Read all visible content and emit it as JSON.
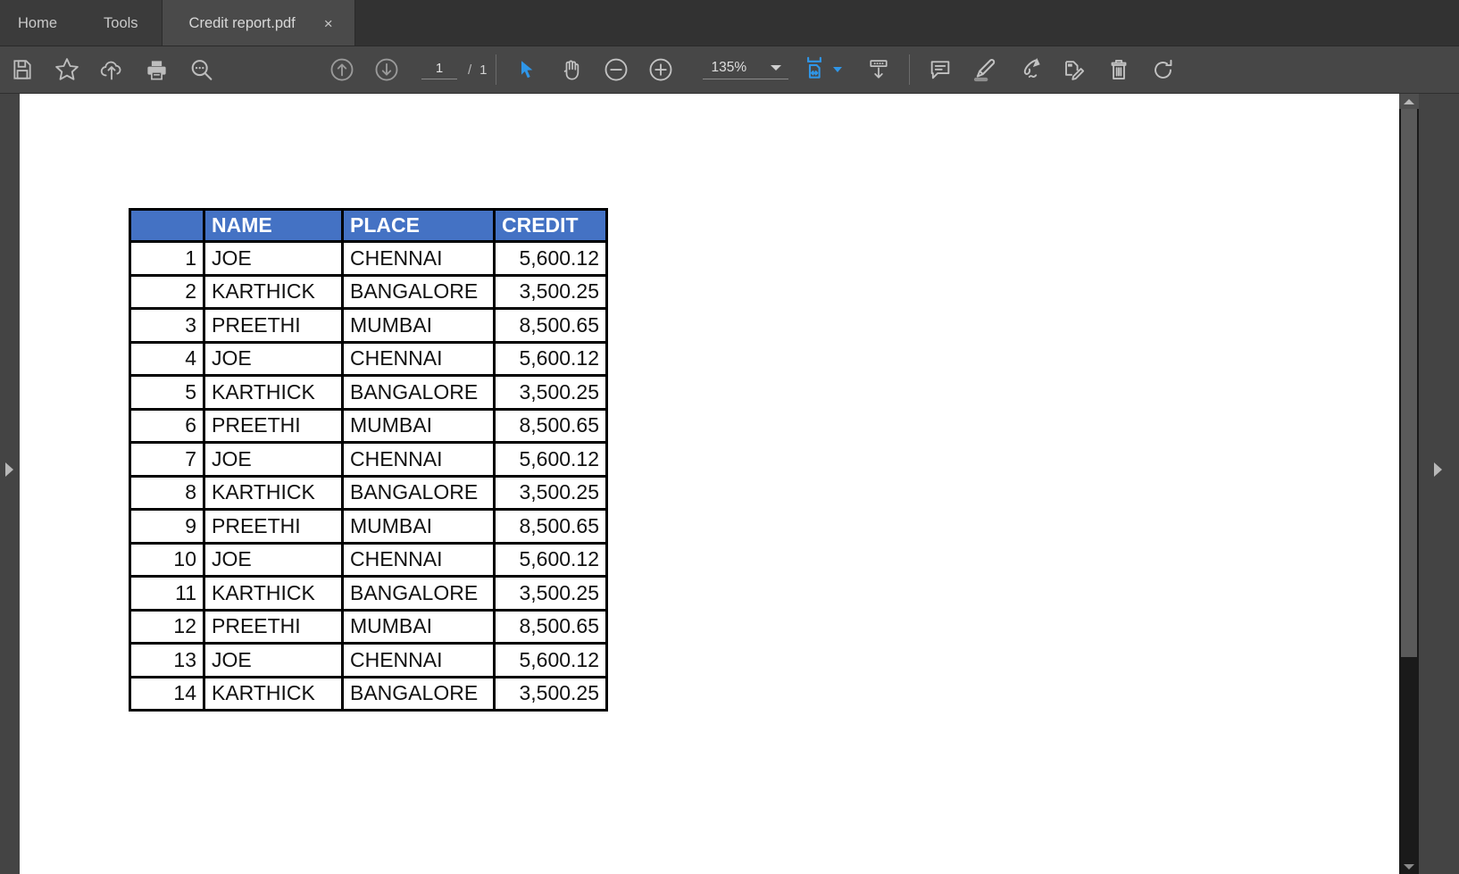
{
  "window": {
    "menu_tabs": [
      {
        "label": "Home",
        "name": "home"
      },
      {
        "label": "Tools",
        "name": "tools"
      }
    ],
    "document_tab": {
      "title": "Credit report.pdf",
      "close_label": "×"
    }
  },
  "toolbar": {
    "left_icons": [
      {
        "name": "save-icon",
        "tooltip": "Save"
      },
      {
        "name": "star-icon",
        "tooltip": "Add to favorites"
      },
      {
        "name": "cloud-upload-icon",
        "tooltip": "Upload to cloud"
      },
      {
        "name": "print-icon",
        "tooltip": "Print file"
      },
      {
        "name": "search-icon",
        "tooltip": "Search"
      }
    ],
    "nav": {
      "previous_page_icon": "arrow-up-circle-icon",
      "next_page_icon": "arrow-down-circle-icon",
      "current_page": "1",
      "page_separator": "/",
      "total_pages": "1"
    },
    "tools": {
      "select_icon": "cursor-arrow-icon",
      "pan_icon": "hand-icon",
      "zoom_out_icon": "minus-circle-icon",
      "zoom_in_icon": "plus-circle-icon",
      "zoom_value": "135%",
      "fit_width_icon": "fit-page-width-icon"
    },
    "right_icons": [
      {
        "name": "page-thumbnails-icon",
        "tooltip": "Page thumbnails"
      },
      {
        "name": "comment-icon",
        "tooltip": "Add comment"
      },
      {
        "name": "highlight-icon",
        "tooltip": "Highlight text"
      },
      {
        "name": "sign-icon",
        "tooltip": "Fill & sign"
      },
      {
        "name": "edit-pdf-icon",
        "tooltip": "Edit PDF"
      },
      {
        "name": "delete-icon",
        "tooltip": "Delete"
      },
      {
        "name": "rotate-icon",
        "tooltip": "Rotate"
      }
    ]
  },
  "colors": {
    "header_blue": "#4472C4",
    "accent_blue": "#2f96e8",
    "chrome_dark": "#3b3b3b",
    "toolbar": "#474747",
    "tab_active": "#4a4a4a"
  },
  "document": {
    "table": {
      "headers": [
        "",
        "NAME",
        "PLACE",
        "CREDIT"
      ],
      "rows": [
        {
          "index": "1",
          "name": "JOE",
          "place": "CHENNAI",
          "credit": "5,600.12"
        },
        {
          "index": "2",
          "name": "KARTHICK",
          "place": "BANGALORE",
          "credit": "3,500.25"
        },
        {
          "index": "3",
          "name": "PREETHI",
          "place": "MUMBAI",
          "credit": "8,500.65"
        },
        {
          "index": "4",
          "name": "JOE",
          "place": "CHENNAI",
          "credit": "5,600.12"
        },
        {
          "index": "5",
          "name": "KARTHICK",
          "place": "BANGALORE",
          "credit": "3,500.25"
        },
        {
          "index": "6",
          "name": "PREETHI",
          "place": "MUMBAI",
          "credit": "8,500.65"
        },
        {
          "index": "7",
          "name": "JOE",
          "place": "CHENNAI",
          "credit": "5,600.12"
        },
        {
          "index": "8",
          "name": "KARTHICK",
          "place": "BANGALORE",
          "credit": "3,500.25"
        },
        {
          "index": "9",
          "name": "PREETHI",
          "place": "MUMBAI",
          "credit": "8,500.65"
        },
        {
          "index": "10",
          "name": "JOE",
          "place": "CHENNAI",
          "credit": "5,600.12"
        },
        {
          "index": "11",
          "name": "KARTHICK",
          "place": "BANGALORE",
          "credit": "3,500.25"
        },
        {
          "index": "12",
          "name": "PREETHI",
          "place": "MUMBAI",
          "credit": "8,500.65"
        },
        {
          "index": "13",
          "name": "JOE",
          "place": "CHENNAI",
          "credit": "5,600.12"
        },
        {
          "index": "14",
          "name": "KARTHICK",
          "place": "BANGALORE",
          "credit": "3,500.25"
        }
      ]
    }
  },
  "panels": {
    "left_toggle_icon": "expand-left-panel-icon",
    "right_toggle_icon": "expand-right-panel-icon"
  }
}
